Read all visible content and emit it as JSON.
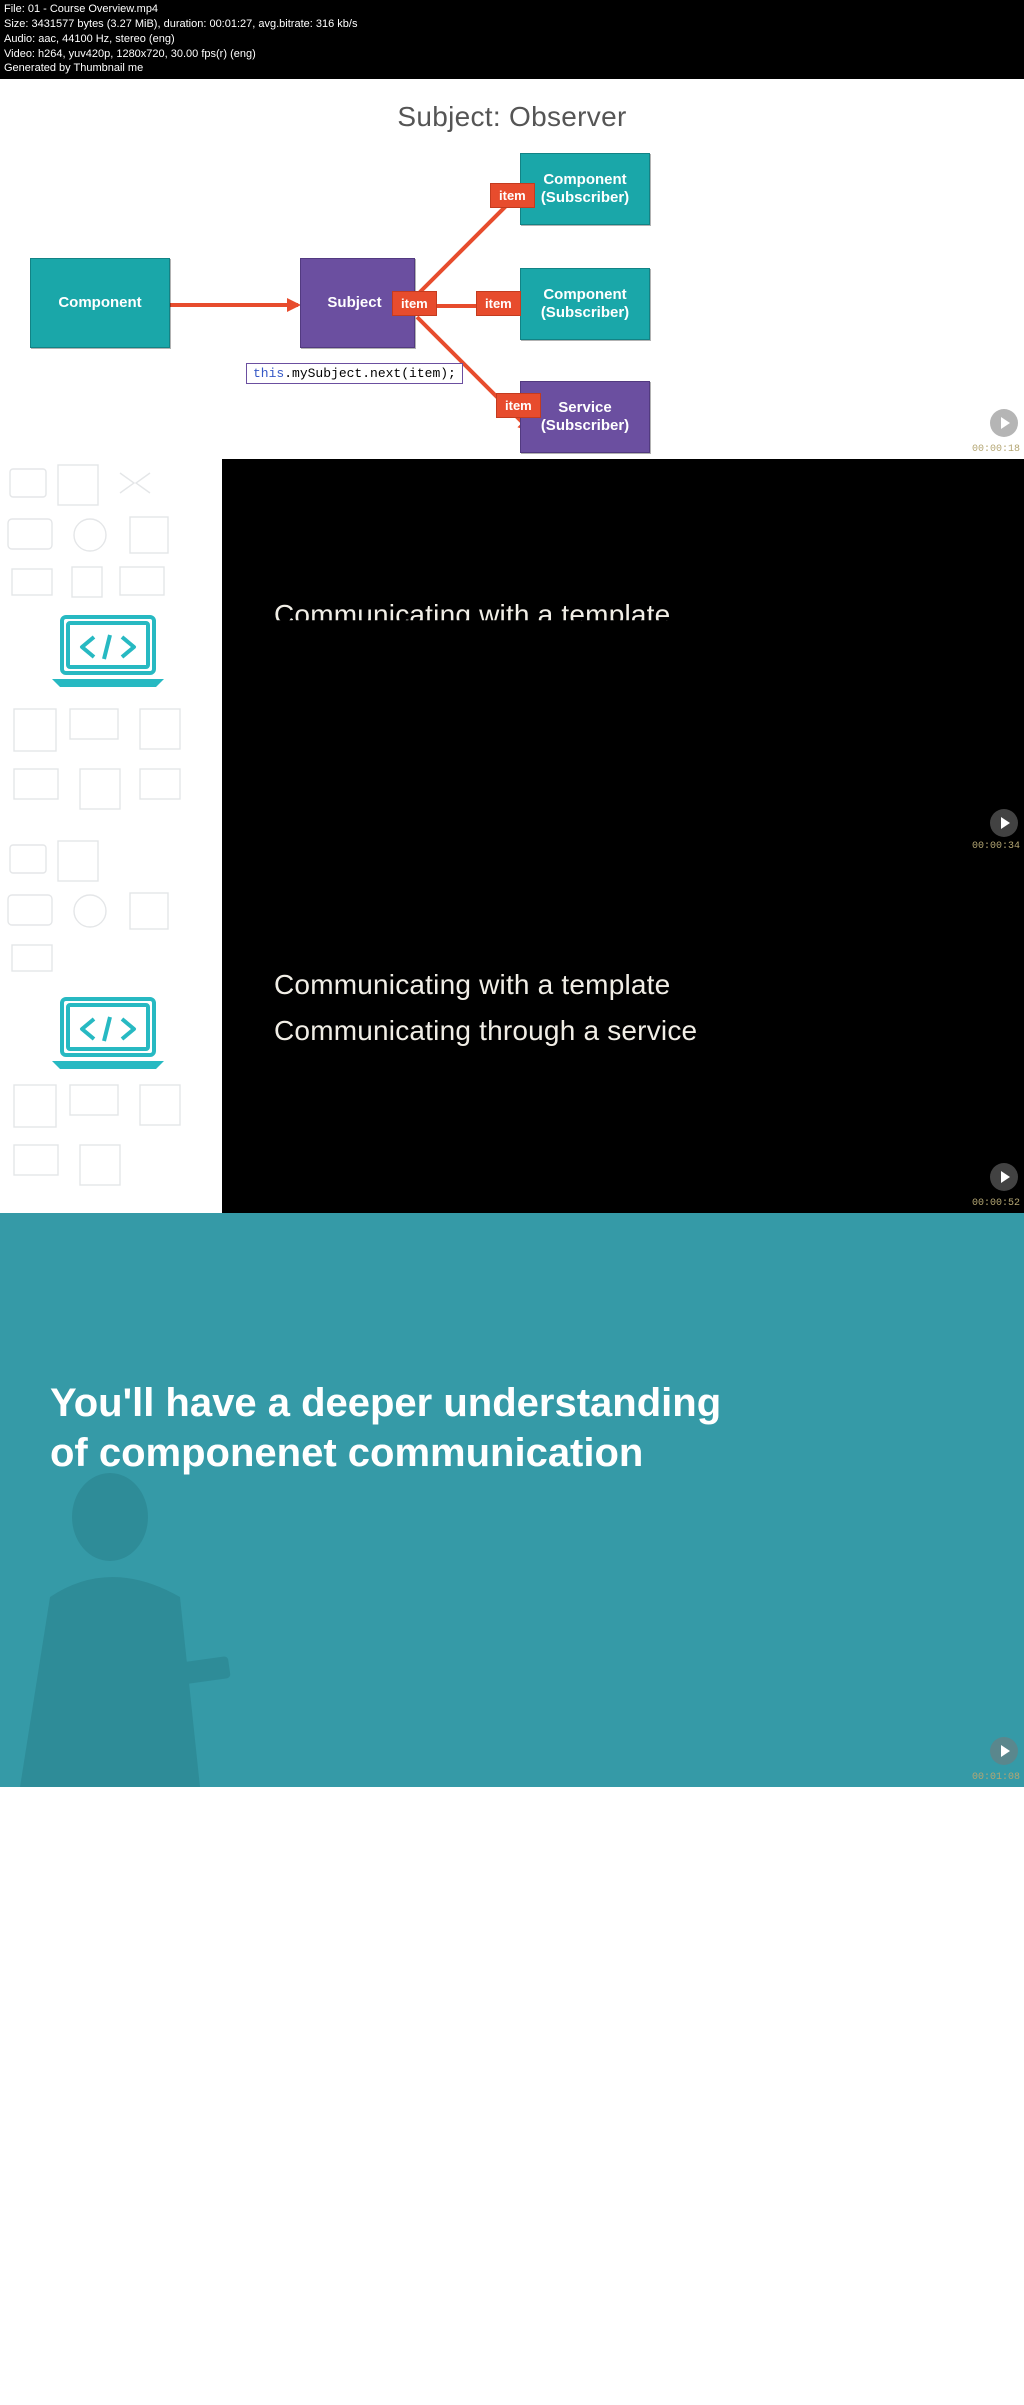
{
  "meta": {
    "file_line": "File: 01 - Course Overview.mp4",
    "size_line": "Size: 3431577 bytes (3.27 MiB), duration: 00:01:27, avg.bitrate: 316 kb/s",
    "audio_line": "Audio: aac, 44100 Hz, stereo (eng)",
    "video_line": "Video: h264, yuv420p, 1280x720, 30.00 fps(r) (eng)",
    "gen_line": "Generated by Thumbnail me"
  },
  "frame1": {
    "title": "Subject: Observer",
    "component_label": "Component",
    "subject_label": "Subject",
    "subscriber1": "Component\n(Subscriber)",
    "subscriber2": "Component\n(Subscriber)",
    "subscriber3": "Service\n(Subscriber)",
    "item_tag": "item",
    "code_kw": "this",
    "code_rest": ".mySubject.next(item);",
    "timestamp": "00:00:18"
  },
  "frame2": {
    "line1": "Communicating with a template",
    "timestamp": "00:00:34"
  },
  "frame3": {
    "line1": "Communicating with a template",
    "line2": "Communicating through a service",
    "timestamp": "00:00:52"
  },
  "frame4": {
    "heading_line1": "You'll have a deeper understanding",
    "heading_line2": "of componenet communication",
    "timestamp": "00:01:08"
  },
  "colors": {
    "teal_box": "#1aa7a9",
    "purple_box": "#6b4fa0",
    "orange_tag": "#e74c2d",
    "slide_bg": "#000000",
    "final_teal": "#359aa7"
  }
}
